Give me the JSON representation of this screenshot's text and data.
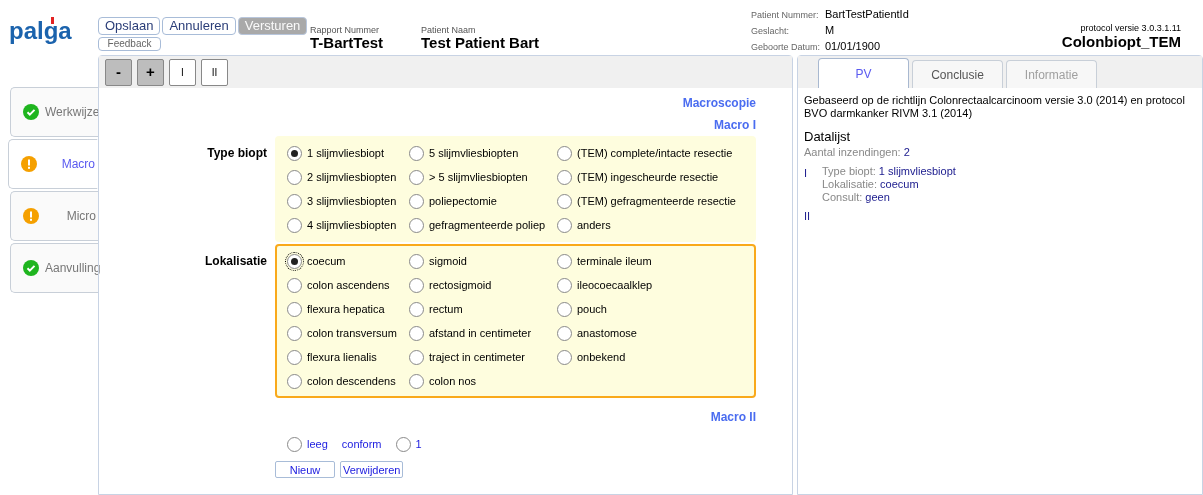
{
  "logo": "palga",
  "header_buttons": [
    {
      "label": "Opslaan",
      "disabled": false
    },
    {
      "label": "Annuleren",
      "disabled": false
    },
    {
      "label": "Versturen",
      "disabled": true
    }
  ],
  "feedback_button": "Feedback",
  "report": {
    "label": "Rapport Nummer",
    "value": "T-BartTest"
  },
  "patient_name": {
    "label": "Patient Naam",
    "value": "Test Patient Bart"
  },
  "patient_info": [
    {
      "label": "Patient Nummer:",
      "value": "BartTestPatientId"
    },
    {
      "label": "Geslacht:",
      "value": "M"
    },
    {
      "label": "Geboorte Datum:",
      "value": "01/01/1900"
    }
  ],
  "protocol": {
    "version": "protocol versie 3.0.3.1.11",
    "name": "Colonbiopt_TEM"
  },
  "sidebar": [
    {
      "label": "Werkwijze",
      "kind": "ok",
      "selected": false
    },
    {
      "label": "Macro",
      "kind": "warning",
      "selected": true
    },
    {
      "label": "Micro",
      "kind": "warning",
      "selected": false
    },
    {
      "label": "Aanvulling",
      "kind": "ok",
      "selected": false
    }
  ],
  "toolbar": [
    {
      "label": "-",
      "kind": "zoom"
    },
    {
      "label": "+",
      "kind": "zoom"
    },
    {
      "label": "I",
      "kind": "section"
    },
    {
      "label": "II",
      "kind": "section"
    }
  ],
  "section_title": "Macroscopie",
  "macro1": {
    "title": "Macro I",
    "fields": [
      {
        "label": "Type biopt",
        "focused": false,
        "options": [
          {
            "label": "1 slijmvliesbiopt",
            "selected": true
          },
          {
            "label": "5 slijmvliesbiopten",
            "selected": false
          },
          {
            "label": "(TEM) complete/intacte resectie",
            "selected": false
          },
          {
            "label": "2 slijmvliesbiopten",
            "selected": false
          },
          {
            "label": "> 5 slijmvliesbiopten",
            "selected": false
          },
          {
            "label": "(TEM) ingescheurde resectie",
            "selected": false
          },
          {
            "label": "3 slijmvliesbiopten",
            "selected": false
          },
          {
            "label": "poliepectomie",
            "selected": false
          },
          {
            "label": "(TEM) gefragmenteerde resectie",
            "selected": false
          },
          {
            "label": "4 slijmvliesbiopten",
            "selected": false
          },
          {
            "label": "gefragmenteerde poliep",
            "selected": false
          },
          {
            "label": "anders",
            "selected": false
          }
        ]
      },
      {
        "label": "Lokalisatie",
        "focused": true,
        "options": [
          {
            "label": "coecum",
            "selected": true
          },
          {
            "label": "sigmoid",
            "selected": false
          },
          {
            "label": "terminale ileum",
            "selected": false
          },
          {
            "label": "colon ascendens",
            "selected": false
          },
          {
            "label": "rectosigmoid",
            "selected": false
          },
          {
            "label": "ileocoecaalklep",
            "selected": false
          },
          {
            "label": "flexura hepatica",
            "selected": false
          },
          {
            "label": "rectum",
            "selected": false
          },
          {
            "label": "pouch",
            "selected": false
          },
          {
            "label": "colon transversum",
            "selected": false
          },
          {
            "label": "afstand in centimeter",
            "selected": false
          },
          {
            "label": "anastomose",
            "selected": false
          },
          {
            "label": "flexura lienalis",
            "selected": false
          },
          {
            "label": "traject in centimeter",
            "selected": false
          },
          {
            "label": "onbekend",
            "selected": false
          },
          {
            "label": "colon descendens",
            "selected": false
          },
          {
            "label": "colon nos",
            "selected": false
          }
        ]
      }
    ]
  },
  "macro2": {
    "title": "Macro II",
    "items": [
      {
        "kind": "radio",
        "label": "leeg",
        "selected": false
      },
      {
        "kind": "link",
        "label": "conform"
      },
      {
        "kind": "radio",
        "label": "1",
        "selected": false
      }
    ],
    "buttons": [
      "Nieuw",
      "Verwijderen"
    ]
  },
  "right_tabs": [
    {
      "label": "PV",
      "selected": true,
      "disabled": false
    },
    {
      "label": "Conclusie",
      "selected": false,
      "disabled": false
    },
    {
      "label": "Informatie",
      "selected": false,
      "disabled": true
    }
  ],
  "pv": {
    "intro": "Gebaseerd op de richtlijn Colonrectaalcarcinoom versie 3.0 (2014) en protocol BVO darmkanker RIVM 3.1 (2014)",
    "heading": "Datalijst",
    "count_label": "Aantal inzendingen:",
    "count": "2",
    "sections": [
      {
        "numeral": "I",
        "fields": [
          {
            "label": "Type biopt:",
            "value": "1 slijmvliesbiopt"
          },
          {
            "label": "Lokalisatie:",
            "value": "coecum"
          },
          {
            "label": "Consult:",
            "value": "geen"
          }
        ]
      },
      {
        "numeral": "II"
      }
    ]
  }
}
